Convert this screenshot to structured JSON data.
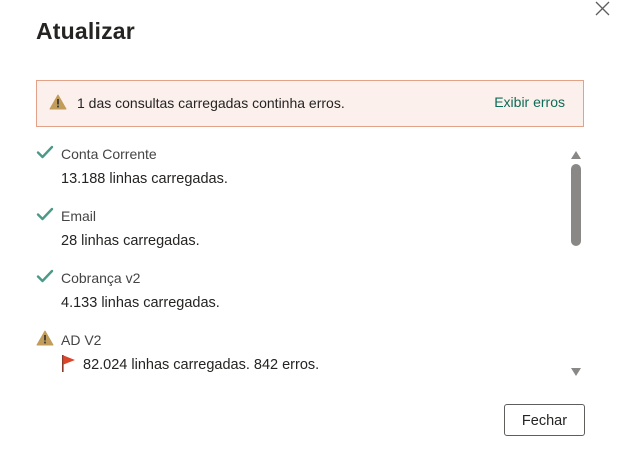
{
  "dialog": {
    "title": "Atualizar",
    "close_icon": "close-icon"
  },
  "banner": {
    "icon": "warning-icon",
    "message": "1 das consultas carregadas continha erros.",
    "link_label": "Exibir erros"
  },
  "queries": [
    {
      "status": "success",
      "icon": "checkmark-icon",
      "name": "Conta Corrente",
      "detail": "13.188 linhas carregadas."
    },
    {
      "status": "success",
      "icon": "checkmark-icon",
      "name": "Email",
      "detail": "28 linhas carregadas."
    },
    {
      "status": "success",
      "icon": "checkmark-icon",
      "name": "Cobrança v2",
      "detail": "4.133 linhas carregadas."
    },
    {
      "status": "warning",
      "icon": "warning-icon",
      "name": "AD V2",
      "detail": "82.024 linhas carregadas. 842 erros.",
      "flag_icon": "flag-icon"
    }
  ],
  "footer": {
    "close_label": "Fechar"
  },
  "colors": {
    "banner_background": "#fbf0eb",
    "banner_border": "#e3a188",
    "link": "#0e6b57",
    "check": "#4a9a87",
    "warning": "#c19c5a",
    "flag": "#d9462c"
  }
}
